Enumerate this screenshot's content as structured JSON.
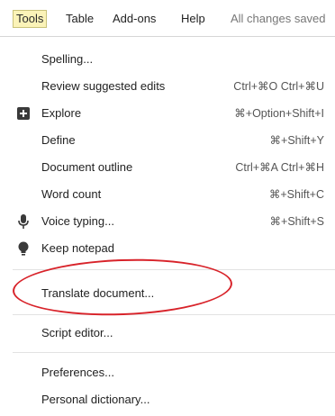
{
  "menubar": {
    "tools": "Tools",
    "table": "Table",
    "addons": "Add-ons",
    "help": "Help",
    "status": "All changes saved"
  },
  "menu": {
    "items": [
      {
        "label": "Spelling...",
        "shortcut": ""
      },
      {
        "label": "Review suggested edits",
        "shortcut": "Ctrl+⌘O Ctrl+⌘U"
      },
      {
        "label": "Explore",
        "shortcut": "⌘+Option+Shift+I",
        "icon": "explore-icon"
      },
      {
        "label": "Define",
        "shortcut": "⌘+Shift+Y"
      },
      {
        "label": "Document outline",
        "shortcut": "Ctrl+⌘A Ctrl+⌘H"
      },
      {
        "label": "Word count",
        "shortcut": "⌘+Shift+C"
      },
      {
        "label": "Voice typing...",
        "shortcut": "⌘+Shift+S",
        "icon": "microphone-icon"
      },
      {
        "label": "Keep notepad",
        "shortcut": "",
        "icon": "lightbulb-icon"
      },
      {
        "label": "Translate document...",
        "shortcut": ""
      },
      {
        "label": "Script editor...",
        "shortcut": ""
      },
      {
        "label": "Preferences...",
        "shortcut": ""
      },
      {
        "label": "Personal dictionary...",
        "shortcut": ""
      }
    ]
  },
  "annotation": {
    "highlight_color": "#d8232a"
  }
}
